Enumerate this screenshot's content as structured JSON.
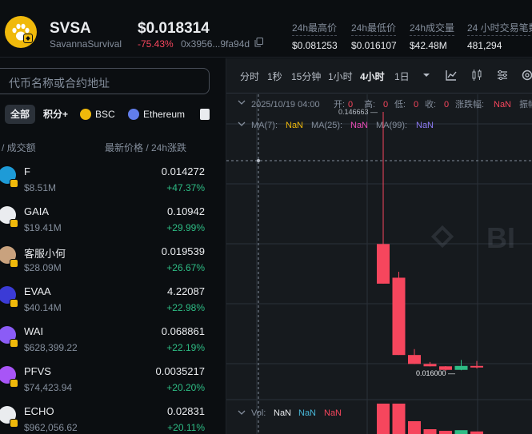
{
  "token": {
    "symbol": "SVSA",
    "name": "SavannaSurvival",
    "price": "$0.018314",
    "change": "-75.43%",
    "address": "0x3956...9fa94d"
  },
  "stats": [
    {
      "label": "24h最高价",
      "value": "$0.081253"
    },
    {
      "label": "24h最低价",
      "value": "$0.016107"
    },
    {
      "label": "24h成交量",
      "value": "$42.48M"
    },
    {
      "label": "24 小时交易笔数",
      "value": "481,294"
    }
  ],
  "search": {
    "placeholder": "代币名称或合约地址"
  },
  "filters": [
    {
      "label": "全部",
      "active": true
    },
    {
      "label": "积分+"
    },
    {
      "label": "BSC",
      "icon": "bsc-icon",
      "color": "#f0b90b"
    },
    {
      "label": "Ethereum",
      "icon": "ethereum-icon",
      "color": "#627eea"
    }
  ],
  "list_header": {
    "left": "/ 成交额",
    "right": "最新价格 / 24h涨跌"
  },
  "tokens": [
    {
      "name": "F",
      "volume": "$8.51M",
      "price": "0.014272",
      "change": "+47.37%",
      "icon_color": "#1e9bd7"
    },
    {
      "name": "GAIA",
      "volume": "$19.41M",
      "price": "0.10942",
      "change": "+29.99%",
      "icon_color": "#eaecef"
    },
    {
      "name": "客服小何",
      "volume": "$28.09M",
      "price": "0.019539",
      "change": "+26.67%",
      "icon_color": "#c9a27e"
    },
    {
      "name": "EVAA",
      "volume": "$40.14M",
      "price": "4.22087",
      "change": "+22.98%",
      "icon_color": "#3b3bd6"
    },
    {
      "name": "WAI",
      "volume": "$628,399.22",
      "price": "0.068861",
      "change": "+22.19%",
      "icon_color": "#8b5cf6"
    },
    {
      "name": "PFVS",
      "volume": "$74,423.94",
      "price": "0.0035217",
      "change": "+20.20%",
      "icon_color": "#a855f7"
    },
    {
      "name": "ECHO",
      "volume": "$962,056.62",
      "price": "0.02831",
      "change": "+20.11%",
      "icon_color": "#eaecef"
    }
  ],
  "timeframes": [
    "分时",
    "1秒",
    "15分钟",
    "1小时",
    "4小时",
    "1日"
  ],
  "active_timeframe": "4小时",
  "ohlc": {
    "date": "2025/10/19 04:00",
    "open_label": "开:",
    "open": "0",
    "high_label": "高:",
    "high": "0",
    "low_label": "低:",
    "low": "0",
    "close_label": "收:",
    "close": "0",
    "change_label": "涨跌幅:",
    "change": "NaN",
    "amp_label": "振幅"
  },
  "ma": [
    {
      "label": "MA(7):",
      "value": "NaN",
      "color": "#f0b90b"
    },
    {
      "label": "MA(25):",
      "value": "NaN",
      "color": "#e94bb6"
    },
    {
      "label": "MA(99):",
      "value": "NaN",
      "color": "#8d7bf5"
    }
  ],
  "vol": {
    "label": "Vol:",
    "values": [
      "NaN",
      "NaN",
      "NaN"
    ],
    "colors": [
      "#eaecef",
      "#48b7d8",
      "#f6465d"
    ]
  },
  "watermark": "BI",
  "colors": {
    "up": "#2ebd85",
    "down": "#f6465d",
    "accent": "#f0b90b"
  },
  "chart_data": {
    "type": "candlestick",
    "annotations": {
      "high_label": "0.146663",
      "low_label": "0.016000"
    },
    "candles": [
      {
        "o": 0.08,
        "h": 0.146663,
        "l": 0.06,
        "c": 0.06
      },
      {
        "o": 0.063,
        "h": 0.066,
        "l": 0.024,
        "c": 0.024
      },
      {
        "o": 0.024,
        "h": 0.027,
        "l": 0.0195,
        "c": 0.0195
      },
      {
        "o": 0.0195,
        "h": 0.0205,
        "l": 0.0182,
        "c": 0.0183
      },
      {
        "o": 0.0183,
        "h": 0.0184,
        "l": 0.016,
        "c": 0.0165
      },
      {
        "o": 0.0165,
        "h": 0.0215,
        "l": 0.0163,
        "c": 0.0185
      },
      {
        "o": 0.0185,
        "h": 0.021,
        "l": 0.0172,
        "c": 0.0183
      }
    ],
    "volumes": [
      0.95,
      0.95,
      0.4,
      0.15,
      0.1,
      0.12,
      0.08
    ]
  }
}
